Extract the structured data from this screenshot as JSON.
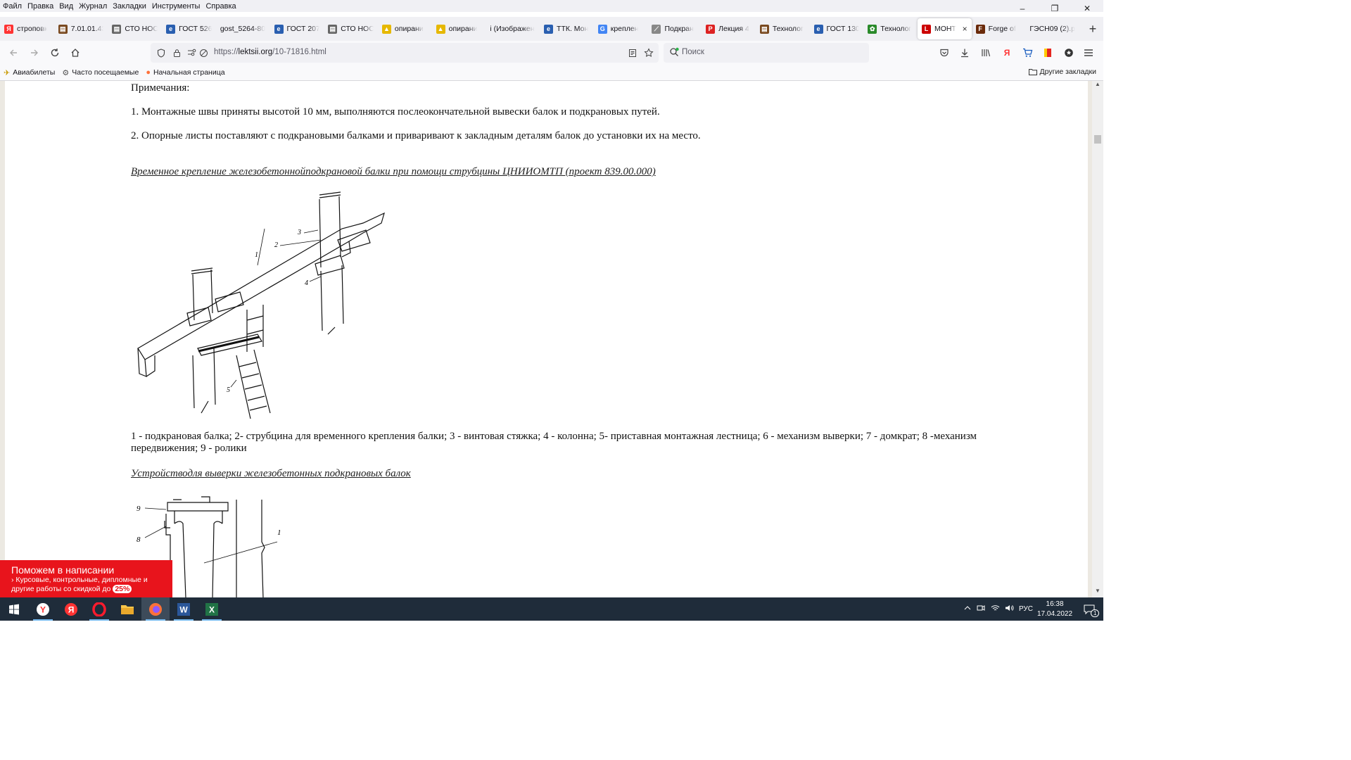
{
  "menu": [
    "Файл",
    "Правка",
    "Вид",
    "Журнал",
    "Закладки",
    "Инструменты",
    "Справка"
  ],
  "tabs": [
    {
      "label": "строповк",
      "icon": "yandex-icon",
      "color": "#f33"
    },
    {
      "label": "7.01.01.43",
      "icon": "doc-icon",
      "color": "#7a4a20"
    },
    {
      "label": "СТО НОС",
      "icon": "doc-icon",
      "color": "#666"
    },
    {
      "label": "ГОСТ 526",
      "icon": "refresh-e-icon",
      "color": "#2a5fb0"
    },
    {
      "label": "gost_5264-80",
      "icon": "",
      "color": ""
    },
    {
      "label": "ГОСТ 207",
      "icon": "refresh-e-icon",
      "color": "#2a5fb0"
    },
    {
      "label": "СТО НОС",
      "icon": "doc-icon",
      "color": "#666"
    },
    {
      "label": "опирани",
      "icon": "image-icon",
      "color": "#e6b800"
    },
    {
      "label": "опирани",
      "icon": "image-icon",
      "color": "#e6b800"
    },
    {
      "label": "i (Изображен",
      "icon": "",
      "color": ""
    },
    {
      "label": "ТТК. Мон",
      "icon": "refresh-e-icon",
      "color": "#2a5fb0"
    },
    {
      "label": "креплен",
      "icon": "google-icon",
      "color": "#4285f4"
    },
    {
      "label": "Подкран",
      "icon": "crane-icon",
      "color": "#888"
    },
    {
      "label": "Лекция 4",
      "icon": "p-icon",
      "color": "#d22"
    },
    {
      "label": "Технолог",
      "icon": "doc-icon",
      "color": "#7a4a20"
    },
    {
      "label": "ГОСТ 130",
      "icon": "refresh-e-icon",
      "color": "#2a5fb0"
    },
    {
      "label": "Технолог",
      "icon": "gear-green-icon",
      "color": "#2a8a2a"
    },
    {
      "label": "МОНТ",
      "icon": "l-icon",
      "color": "#c00",
      "active": true
    },
    {
      "label": "Forge of",
      "icon": "forge-icon",
      "color": "#6a2a0a"
    },
    {
      "label": "ГЭСН09 (2).p",
      "icon": "",
      "color": ""
    }
  ],
  "tab_close": "×",
  "newtab": "+",
  "window_controls": [
    "–",
    "❐",
    "✕"
  ],
  "url": {
    "prefix": "https://",
    "host": "lektsii.org",
    "path": "/10-71816.html"
  },
  "search": {
    "placeholder": "Поиск"
  },
  "bookmarks": [
    {
      "label": "Авиабилеты",
      "icon": "plane-icon"
    },
    {
      "label": "Часто посещаемые",
      "icon": "gear-icon"
    },
    {
      "label": "Начальная страница",
      "icon": "firefox-icon"
    }
  ],
  "other_bookmarks": "Другие закладки",
  "page": {
    "notes_title": "Примечания:",
    "note1": "1. Монтажные швы приняты высотой 10 мм, выполняются послеокончательной вывески балок и подкрановых путей.",
    "note2": "2. Опорные листы поставляют с подкрановыми балками и приваривают к закладным деталям балок до установки их на место.",
    "heading1": "Временное крепление железобетоннойподкрановой балки при помощи струбцины ЦНИИОМТП (проект 839.00.000)",
    "legend": "1 - подкрановая балка; 2- струбцина для временного крепления балки; 3 - винтовая стяжка; 4 - колонна; 5- приставная монтажная лестница; 6 - механизм выверки; 7 - домкрат; 8 -механизм передвижения; 9 - ролики",
    "heading2": "Устройстводля выверки железобетонных подкрановых балок",
    "fig1_labels": [
      "1",
      "2",
      "3",
      "4",
      "5"
    ],
    "fig2_labels": [
      "9",
      "8",
      "1"
    ]
  },
  "ad": {
    "title": "Поможем в написании",
    "subtitle": "› Курсовые, контрольные, дипломные и другие работы со скидкой до",
    "badge": "25%"
  },
  "taskbar": {
    "apps": [
      "windows-start-icon",
      "yandex-browser-icon",
      "yandex-icon",
      "opera-icon",
      "file-explorer-icon",
      "firefox-icon",
      "word-icon",
      "excel-icon"
    ],
    "lang": "РУС",
    "time": "16:38",
    "date": "17.04.2022",
    "notifications": "1"
  }
}
